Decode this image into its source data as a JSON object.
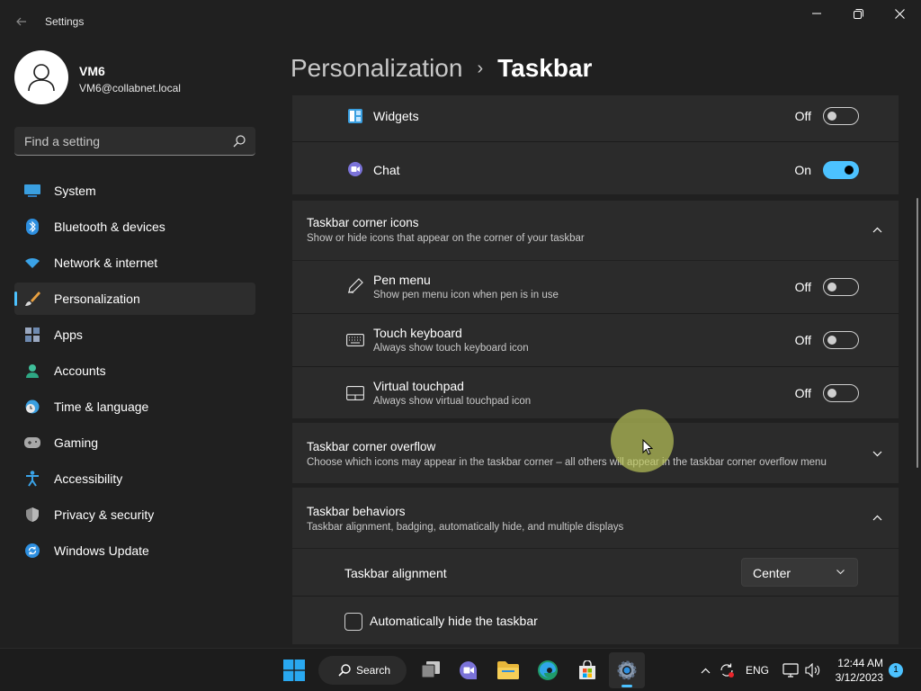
{
  "window": {
    "title": "Settings"
  },
  "profile": {
    "name": "VM6",
    "email": "VM6@collabnet.local"
  },
  "search": {
    "placeholder": "Find a setting"
  },
  "sidebar": {
    "items": [
      {
        "label": "System",
        "icon": "system-icon"
      },
      {
        "label": "Bluetooth & devices",
        "icon": "bluetooth-icon"
      },
      {
        "label": "Network & internet",
        "icon": "wifi-icon"
      },
      {
        "label": "Personalization",
        "icon": "brush-icon",
        "active": true
      },
      {
        "label": "Apps",
        "icon": "apps-icon"
      },
      {
        "label": "Accounts",
        "icon": "person-icon"
      },
      {
        "label": "Time & language",
        "icon": "clock-globe-icon"
      },
      {
        "label": "Gaming",
        "icon": "gamepad-icon"
      },
      {
        "label": "Accessibility",
        "icon": "accessibility-icon"
      },
      {
        "label": "Privacy & security",
        "icon": "shield-icon"
      },
      {
        "label": "Windows Update",
        "icon": "update-icon"
      }
    ]
  },
  "breadcrumb": {
    "parent": "Personalization",
    "separator": "›",
    "current": "Taskbar"
  },
  "taskbar_items": {
    "widgets": {
      "label": "Widgets",
      "state": "Off",
      "on": false
    },
    "chat": {
      "label": "Chat",
      "state": "On",
      "on": true
    }
  },
  "corner_icons": {
    "title": "Taskbar corner icons",
    "subtitle": "Show or hide icons that appear on the corner of your taskbar",
    "expanded": true,
    "items": [
      {
        "title": "Pen menu",
        "subtitle": "Show pen menu icon when pen is in use",
        "state": "Off",
        "on": false
      },
      {
        "title": "Touch keyboard",
        "subtitle": "Always show touch keyboard icon",
        "state": "Off",
        "on": false
      },
      {
        "title": "Virtual touchpad",
        "subtitle": "Always show virtual touchpad icon",
        "state": "Off",
        "on": false
      }
    ]
  },
  "corner_overflow": {
    "title": "Taskbar corner overflow",
    "subtitle": "Choose which icons may appear in the taskbar corner – all others will appear in the taskbar corner overflow menu",
    "expanded": false
  },
  "behaviors": {
    "title": "Taskbar behaviors",
    "subtitle": "Taskbar alignment, badging, automatically hide, and multiple displays",
    "expanded": true,
    "alignment_label": "Taskbar alignment",
    "alignment_value": "Center",
    "autohide_label": "Automatically hide the taskbar",
    "autohide_checked": false
  },
  "taskbar": {
    "search_label": "Search",
    "language": "ENG",
    "time": "12:44 AM",
    "date": "3/12/2023",
    "notification_count": "1"
  },
  "colors": {
    "accent": "#4cc2ff",
    "background": "#202020",
    "card": "#2b2b2b"
  }
}
